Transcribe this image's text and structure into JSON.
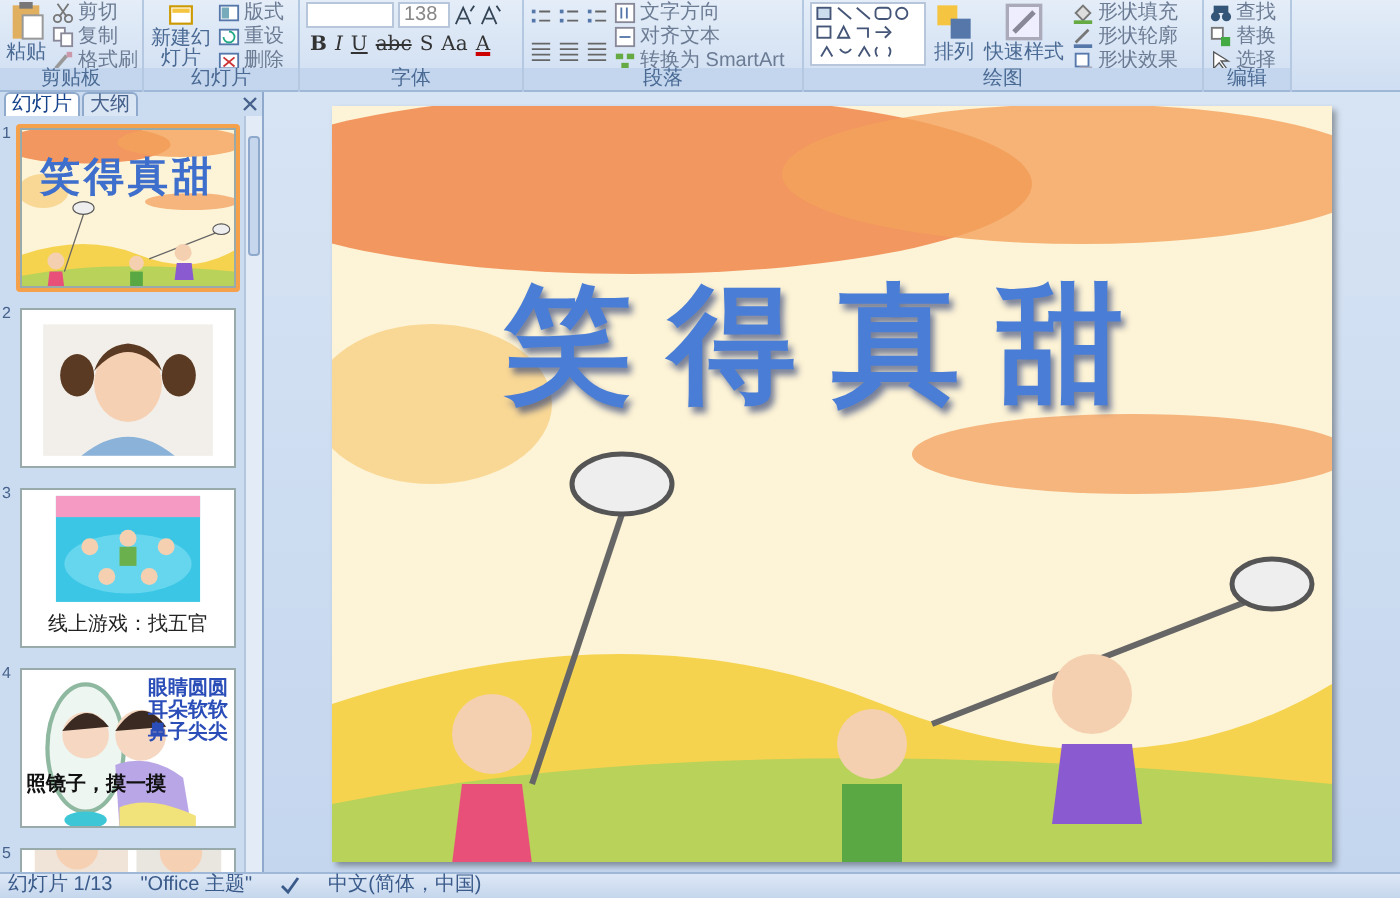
{
  "ribbon": [
    {
      "label": "剪贴板",
      "buttons": [
        "粘贴",
        "剪切",
        "复制",
        "格式刷"
      ]
    },
    {
      "label": "幻灯片",
      "buttons": [
        "新建幻灯片",
        "版式",
        "重设",
        "删除"
      ]
    },
    {
      "label": "字体",
      "font_size": "138",
      "buttons": [
        "B",
        "I",
        "U",
        "abc",
        "S",
        "Aa",
        "A"
      ]
    },
    {
      "label": "段落",
      "buttons": [
        "文字方向",
        "对齐文本",
        "转换为 SmartArt"
      ]
    },
    {
      "label": "绘图",
      "buttons": [
        "排列",
        "快速样式",
        "形状填充",
        "形状轮廓",
        "形状效果"
      ]
    },
    {
      "label": "编辑",
      "buttons": [
        "查找",
        "替换",
        "选择"
      ]
    }
  ],
  "panel_tabs": [
    {
      "label": "幻灯片",
      "selected": true
    },
    {
      "label": "大纲",
      "selected": false
    }
  ],
  "slides": [
    {
      "number": "1",
      "selected": true,
      "kind": "title",
      "title": "笑得真甜"
    },
    {
      "number": "2",
      "selected": false
    },
    {
      "number": "3",
      "selected": false,
      "kind": "caption",
      "caption": "线上游戏：找五官"
    },
    {
      "number": "4",
      "selected": false,
      "kind": "rhyme",
      "caption": "照镜子，摸一摸",
      "lines": [
        "眼睛圆圆",
        "耳朵软软",
        "鼻子尖尖"
      ]
    },
    {
      "number": "5",
      "selected": false,
      "kind": "cut"
    }
  ],
  "main_slide": {
    "title": "笑得真甜"
  },
  "status_bar": {
    "slide": "幻灯片 1/13",
    "theme": "\"Office 主题\"",
    "language": "中文(简体，中国)"
  }
}
